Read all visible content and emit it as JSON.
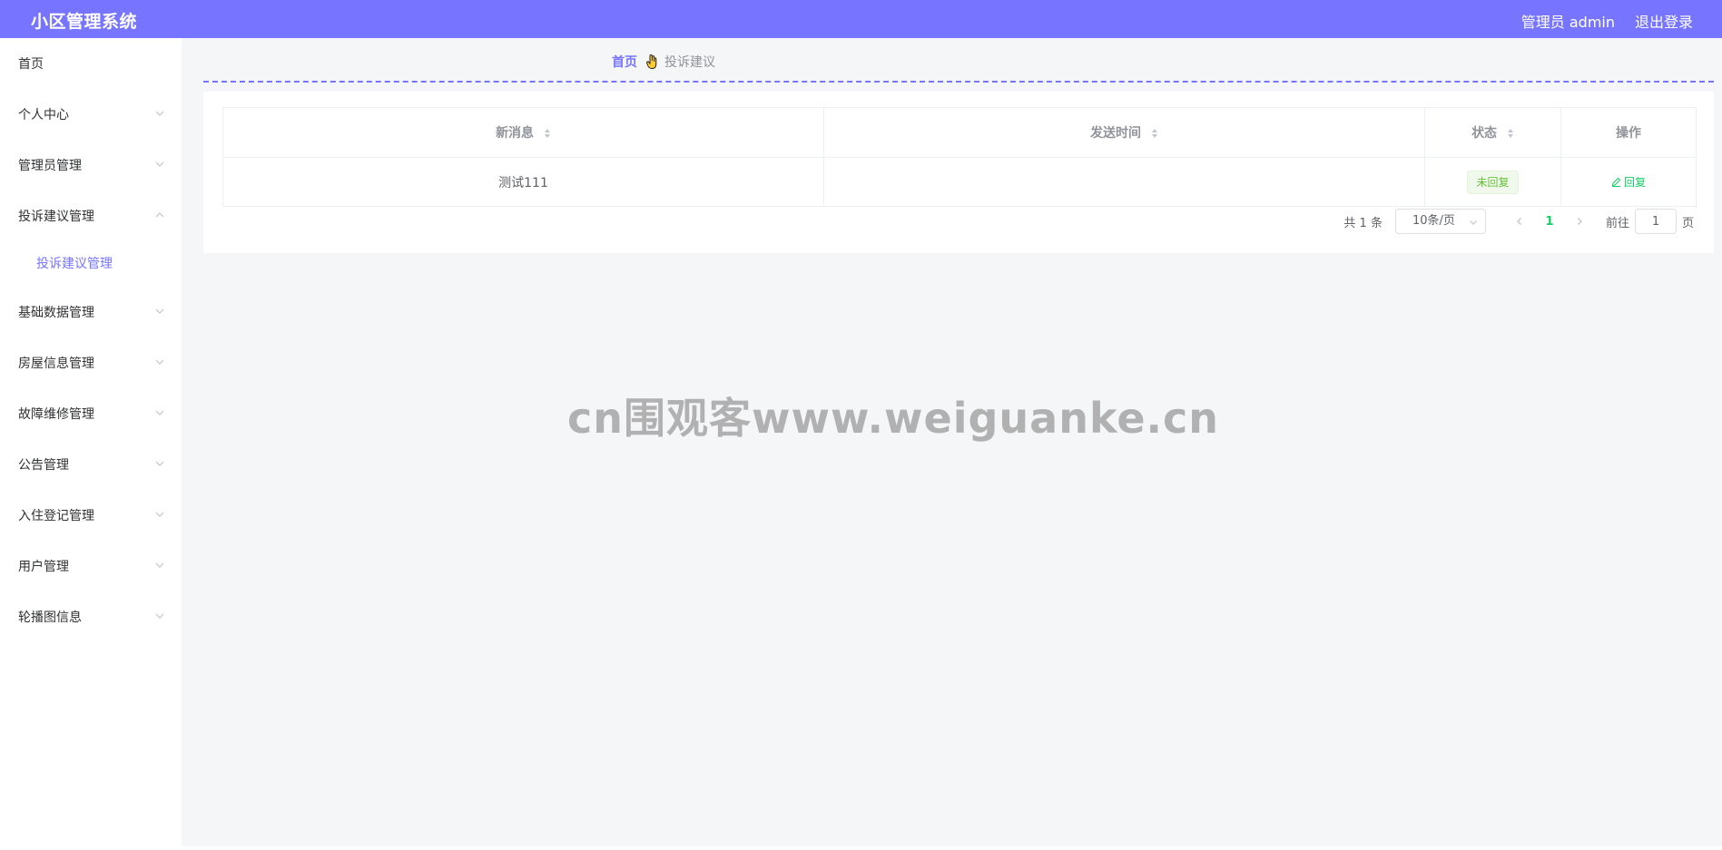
{
  "header": {
    "title": "小区管理系统",
    "user_label": "管理员 admin",
    "logout_label": "退出登录",
    "color": "#7775ff"
  },
  "sidebar": {
    "items": [
      {
        "label": "首页",
        "expandable": false
      },
      {
        "label": "个人中心",
        "expandable": true,
        "icon": "chevron-down-icon"
      },
      {
        "label": "管理员管理",
        "expandable": true,
        "icon": "chevron-down-icon"
      },
      {
        "label": "投诉建议管理",
        "expandable": true,
        "expanded": true,
        "icon": "chevron-up-icon",
        "children": [
          {
            "label": "投诉建议管理",
            "active": true
          }
        ]
      },
      {
        "label": "基础数据管理",
        "expandable": true,
        "icon": "chevron-down-icon"
      },
      {
        "label": "房屋信息管理",
        "expandable": true,
        "icon": "chevron-down-icon"
      },
      {
        "label": "故障维修管理",
        "expandable": true,
        "icon": "chevron-down-icon"
      },
      {
        "label": "公告管理",
        "expandable": true,
        "icon": "chevron-down-icon"
      },
      {
        "label": "入住登记管理",
        "expandable": true,
        "icon": "chevron-down-icon"
      },
      {
        "label": "用户管理",
        "expandable": true,
        "icon": "chevron-down-icon"
      },
      {
        "label": "轮播图信息",
        "expandable": true,
        "icon": "chevron-down-icon"
      }
    ]
  },
  "breadcrumb": {
    "home": "首页",
    "separator_icon": "hand-icon",
    "current": "投诉建议"
  },
  "table": {
    "columns": [
      {
        "label": "新消息",
        "sortable": true
      },
      {
        "label": "发送时间",
        "sortable": true
      },
      {
        "label": "状态",
        "sortable": true
      },
      {
        "label": "操作",
        "sortable": false
      }
    ],
    "rows": [
      {
        "message": "测试111",
        "send_time": "",
        "status": "未回复",
        "action": "回复"
      }
    ]
  },
  "pagination": {
    "total": "共 1 条",
    "page_size": "10条/页",
    "current_page": "1",
    "goto_label": "前往",
    "goto_value": "1",
    "page_suffix": "页"
  },
  "watermark": "cn围观客www.weiguanke.cn"
}
